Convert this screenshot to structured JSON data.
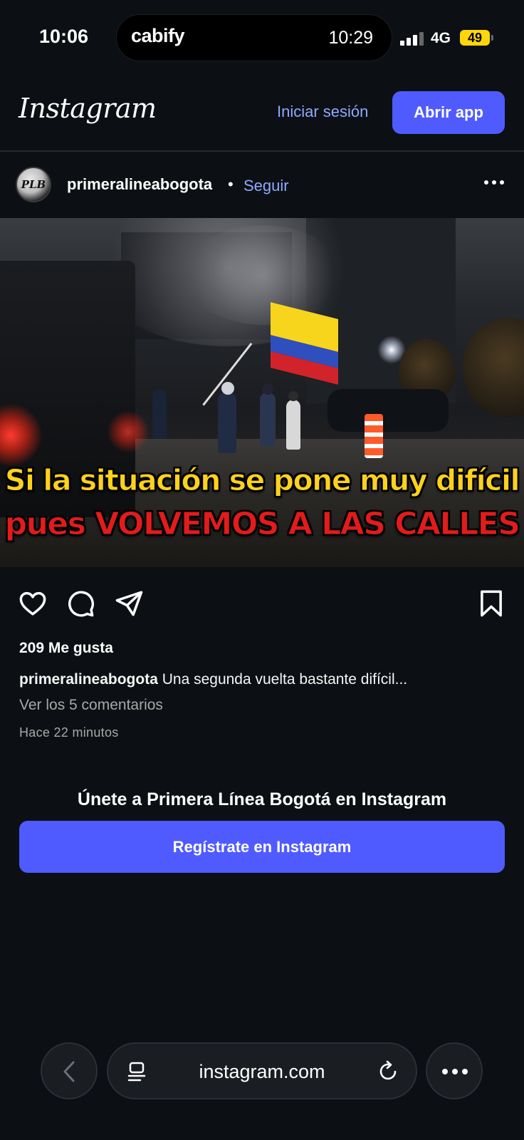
{
  "status_bar": {
    "time": "10:06",
    "island_app": "cabify",
    "island_time": "10:29",
    "network": "4G",
    "battery": "49"
  },
  "header": {
    "logo": "Instagram",
    "login_label": "Iniciar sesión",
    "open_app_label": "Abrir app"
  },
  "post": {
    "avatar_text": "PLB",
    "username": "primeralineabogota",
    "separator": "•",
    "follow_label": "Seguir",
    "image_caption_line1": "Si la situación se pone muy difícil",
    "image_caption_line2": "pues VOLVEMOS A LAS CALLES",
    "likes": "209 Me gusta",
    "caption_user": "primeralineabogota",
    "caption_text": "Una segunda vuelta bastante difícil...",
    "comments_link": "Ver los 5 comentarios",
    "timestamp": "Hace 22 minutos"
  },
  "join": {
    "title": "Únete a Primera Línea Bogotá en Instagram",
    "signup_label": "Regístrate en Instagram"
  },
  "browser": {
    "url": "instagram.com"
  },
  "colors": {
    "background": "#0c1014",
    "accent": "#4f5bff",
    "link": "#8fa8ff",
    "muted": "#a8a8a8"
  }
}
